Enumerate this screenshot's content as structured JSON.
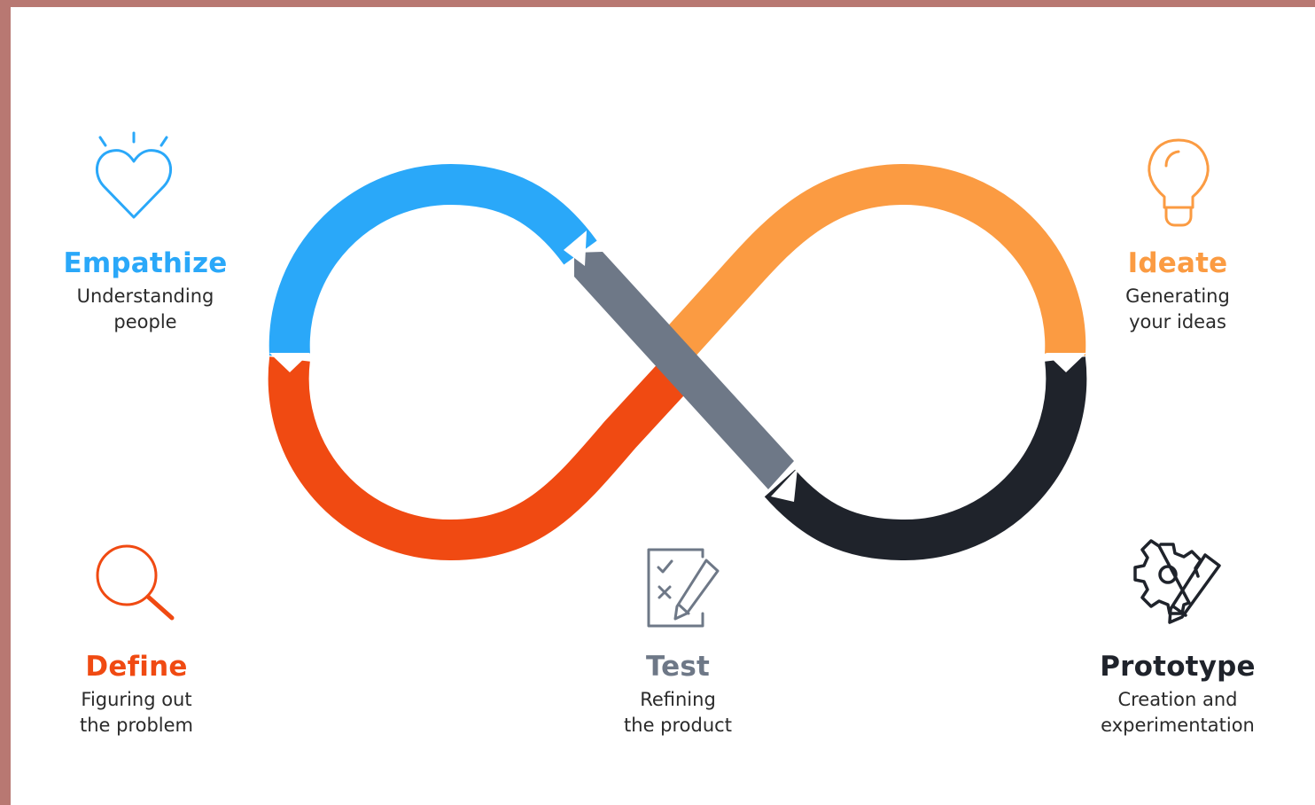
{
  "colors": {
    "empathize": "#2aa8f9",
    "define": "#f04a12",
    "ideate": "#fb9b42",
    "prototype": "#1f232b",
    "test": "#6e7887",
    "icon_dark": "#1f232b",
    "border": "#b87872"
  },
  "stages": {
    "empathize": {
      "title": "Empathize",
      "line1": "Understanding",
      "line2": "people",
      "icon": "heart-icon"
    },
    "ideate": {
      "title": "Ideate",
      "line1": "Generating",
      "line2": "your ideas",
      "icon": "lightbulb-icon"
    },
    "define": {
      "title": "Define",
      "line1": "Figuring out",
      "line2": "the problem",
      "icon": "magnifier-icon"
    },
    "test": {
      "title": "Test",
      "line1": "Refining",
      "line2": "the product",
      "icon": "checklist-icon"
    },
    "prototype": {
      "title": "Prototype",
      "line1": "Creation and",
      "line2": "experimentation",
      "icon": "gear-pencil-icon"
    }
  }
}
